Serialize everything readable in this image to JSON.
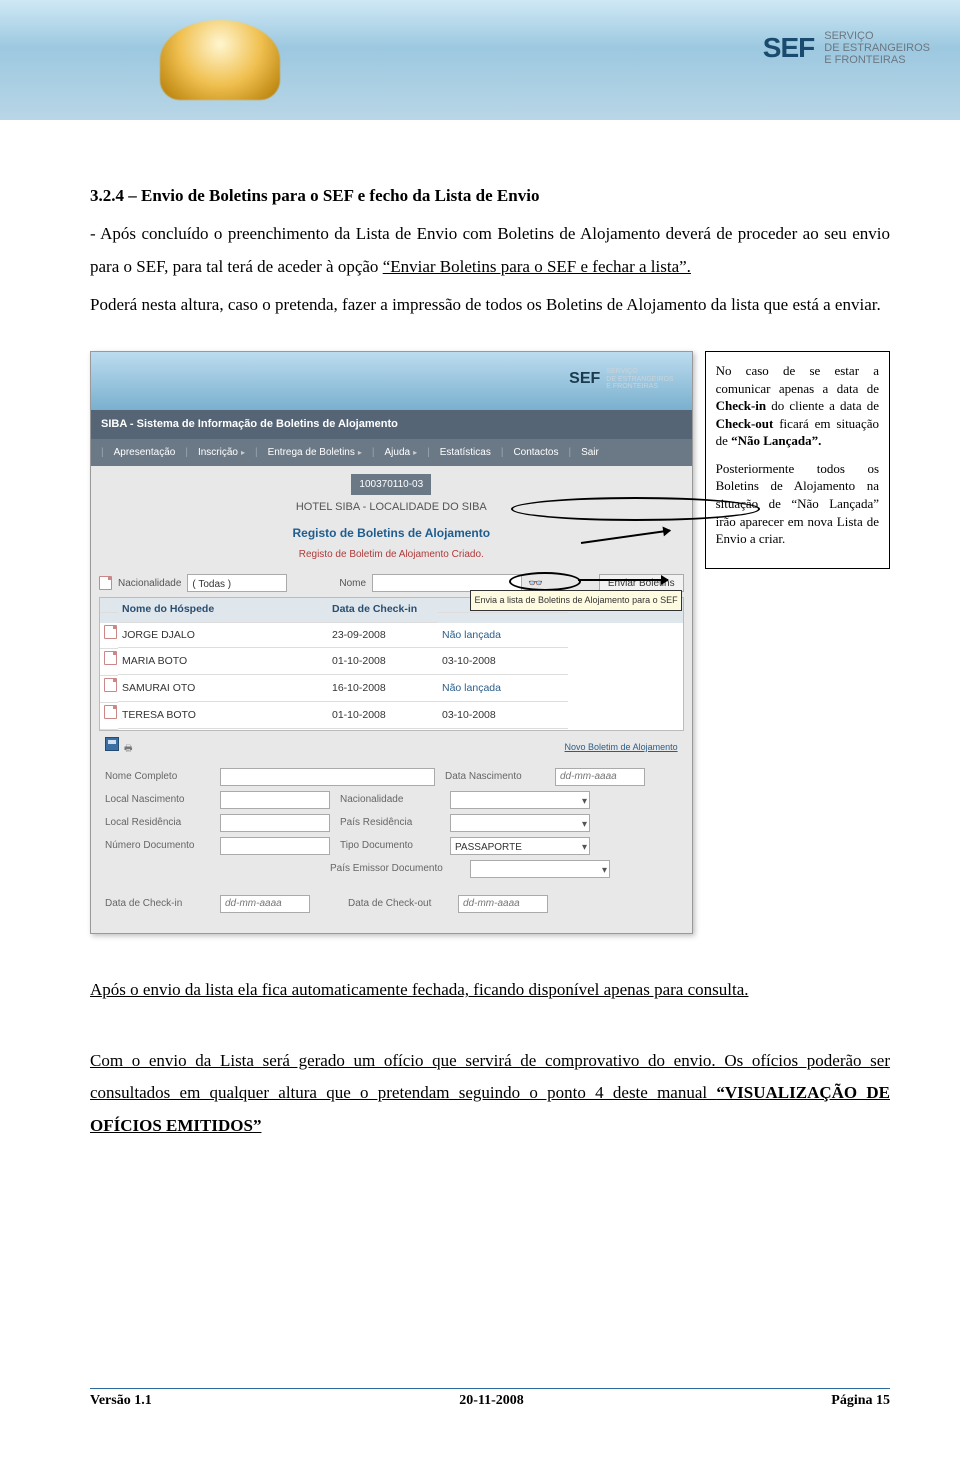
{
  "banner": {
    "logo": "SEF",
    "tagline1": "SERVIÇO",
    "tagline2": "DE ESTRANGEIROS",
    "tagline3": "E FRONTEIRAS"
  },
  "body": {
    "title": "3.2.4 – Envio de Boletins para o SEF e fecho da Lista de Envio",
    "para1_a": "- Após concluído o preenchimento da Lista de Envio com Boletins de Alojamento deverá de proceder ao seu envio para o SEF, para tal terá de aceder à opção ",
    "para1_link": "“Enviar Boletins para o SEF e fechar a lista”.",
    "para2": "Poderá nesta altura, caso o pretenda, fazer a impressão de todos os Boletins de Alojamento da lista que está a enviar.",
    "para3_a": "Após o envio da lista ela fica automaticamente fechada, ficando disponível apenas para consulta.",
    "para4": "Com o envio da Lista será gerado um ofício que servirá de comprovativo do envio. Os ofícios poderão ser consultados em qualquer altura que o pretendam seguindo o ponto 4 deste manual ",
    "para4_quote": "“VISUALIZAÇÃO DE OFÍCIOS EMITIDOS”"
  },
  "callout": {
    "p1_a": "No caso de se estar a comunicar apenas a data de ",
    "p1_b": "Check-in",
    "p1_c": " do cliente a data de ",
    "p1_d": "Check-out",
    "p1_e": " ficará em situação de ",
    "p1_f": "“Não Lançada”.",
    "p2": "Posteriormente todos os Boletins de Alojamento na situação de “Não Lançada” irão aparecer em nova Lista de Envio a criar."
  },
  "app": {
    "logo": "SEF",
    "logosub1": "SERVIÇO",
    "logosub2": "DE ESTRANGEIROS",
    "logosub3": "E FRONTEIRAS",
    "title": "SIBA - Sistema de Informação de Boletins de Alojamento",
    "menu": [
      "Apresentação",
      "Inscrição",
      "Entrega de Boletins",
      "Ajuda",
      "Estatísticas",
      "Contactos",
      "Sair"
    ],
    "hotel_id": "100370110-03",
    "hotel_name": "HOTEL SIBA - LOCALIDADE DO SIBA",
    "reg_title": "Registo de Boletins de Alojamento",
    "reg_sub": "Registo de Boletim de Alojamento Criado.",
    "filter": {
      "nac_label": "Nacionalidade",
      "nac_value": "( Todas )",
      "nome_label": "Nome",
      "btn_enviar": "Enviar Boletins",
      "tooltip": "Envia a lista de Boletins de Alojamento para o SEF"
    },
    "grid": {
      "cols": [
        "",
        "Nome do Hóspede",
        "Data de Check-in",
        ""
      ],
      "rows": [
        {
          "nome": "JORGE DJALO",
          "checkin": "23-09-2008",
          "status": "Não lançada"
        },
        {
          "nome": "MARIA BOTO",
          "checkin": "01-10-2008",
          "status": "03-10-2008"
        },
        {
          "nome": "SAMURAI OTO",
          "checkin": "16-10-2008",
          "status": "Não lançada"
        },
        {
          "nome": "TERESA BOTO",
          "checkin": "01-10-2008",
          "status": "03-10-2008"
        }
      ]
    },
    "newlink": "Novo Boletim de Alojamento",
    "form": {
      "nome_lbl": "Nome Completo",
      "data_nasc_lbl": "Data Nascimento",
      "data_nasc_ph": "dd-mm-aaaa",
      "local_nasc_lbl": "Local Nascimento",
      "nac_lbl": "Nacionalidade",
      "local_res_lbl": "Local Residência",
      "pais_res_lbl": "País Residência",
      "num_doc_lbl": "Número Documento",
      "tipo_doc_lbl": "Tipo Documento",
      "tipo_doc_val": "PASSAPORTE",
      "pais_emi_lbl": "País Emissor Documento",
      "checkin_lbl": "Data de Check-in",
      "checkin_ph": "dd-mm-aaaa",
      "checkout_lbl": "Data de Check-out",
      "checkout_ph": "dd-mm-aaaa"
    }
  },
  "footer": {
    "version": "Versão 1.1",
    "date": "20-11-2008",
    "page": "Página 15"
  }
}
